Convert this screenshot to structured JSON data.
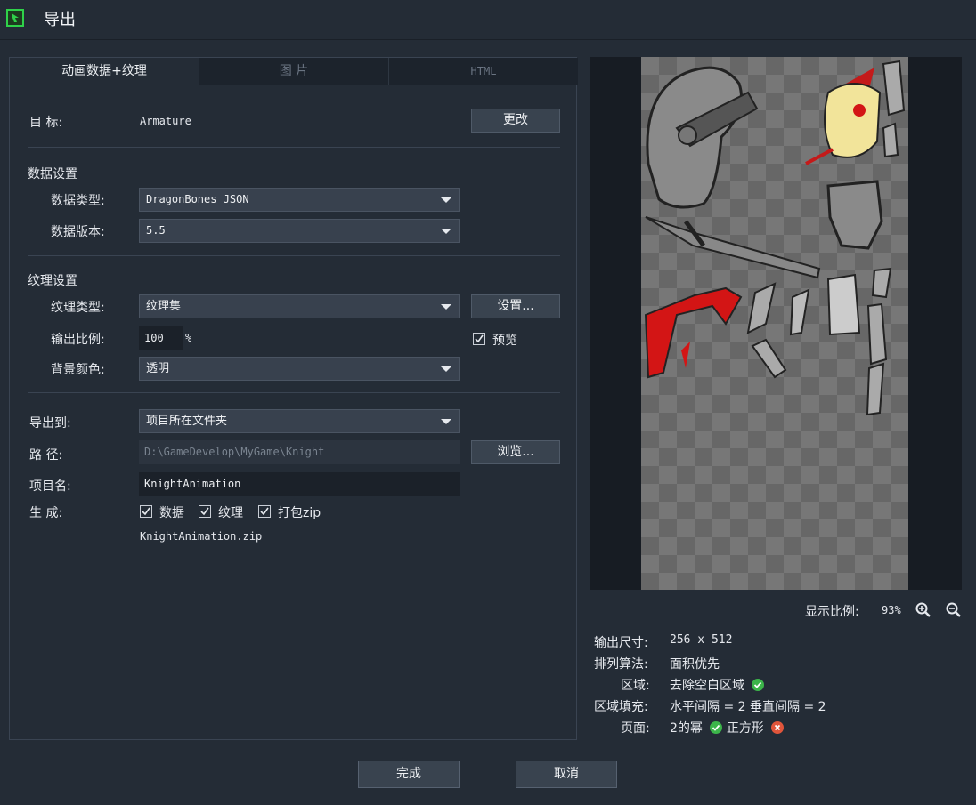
{
  "window": {
    "title": "导出"
  },
  "tabs": [
    {
      "label": "动画数据+纹理"
    },
    {
      "label": "图 片"
    },
    {
      "label": "HTML"
    }
  ],
  "target": {
    "label": "目  标:",
    "value": "Armature",
    "change_button": "更改"
  },
  "data_settings": {
    "header": "数据设置",
    "type_label": "数据类型:",
    "type_value": "DragonBones JSON",
    "version_label": "数据版本:",
    "version_value": "5.5"
  },
  "texture_settings": {
    "header": "纹理设置",
    "type_label": "纹理类型:",
    "type_value": "纹理集",
    "settings_button": "设置...",
    "scale_label": "输出比例:",
    "scale_value": "100",
    "scale_unit": "%",
    "preview_label": "预览",
    "preview_checked": true,
    "bg_label": "背景颜色:",
    "bg_value": "透明"
  },
  "export": {
    "dest_label": "导出到:",
    "dest_value": "项目所在文件夹",
    "path_label": "路  径:",
    "path_value": "D:\\GameDevelop\\MyGame\\Knight",
    "browse_button": "浏览...",
    "name_label": "项目名:",
    "name_value": "KnightAnimation",
    "generate_label": "生  成:",
    "generate_options": [
      {
        "label": "数据",
        "checked": true
      },
      {
        "label": "纹理",
        "checked": true
      },
      {
        "label": "打包zip",
        "checked": true
      }
    ],
    "output_file": "KnightAnimation.zip"
  },
  "preview": {
    "zoom_label": "显示比例:",
    "zoom_value": "93%",
    "info": [
      {
        "label": "输出尺寸:",
        "value": "256 x 512"
      },
      {
        "label": "排列算法:",
        "value": "面积优先"
      },
      {
        "label": "区域:",
        "value": "去除空白区域"
      },
      {
        "label": "区域填充:",
        "value": "水平间隔 = 2 垂直间隔 = 2"
      },
      {
        "label": "页面:",
        "value": "2的幂",
        "value2": "正方形"
      }
    ]
  },
  "footer": {
    "ok_button": "完成",
    "cancel_button": "取消"
  },
  "colors": {
    "accent_green": "#3cb54a",
    "error_red": "#e0553b",
    "app_icon": "#2fd24a"
  }
}
